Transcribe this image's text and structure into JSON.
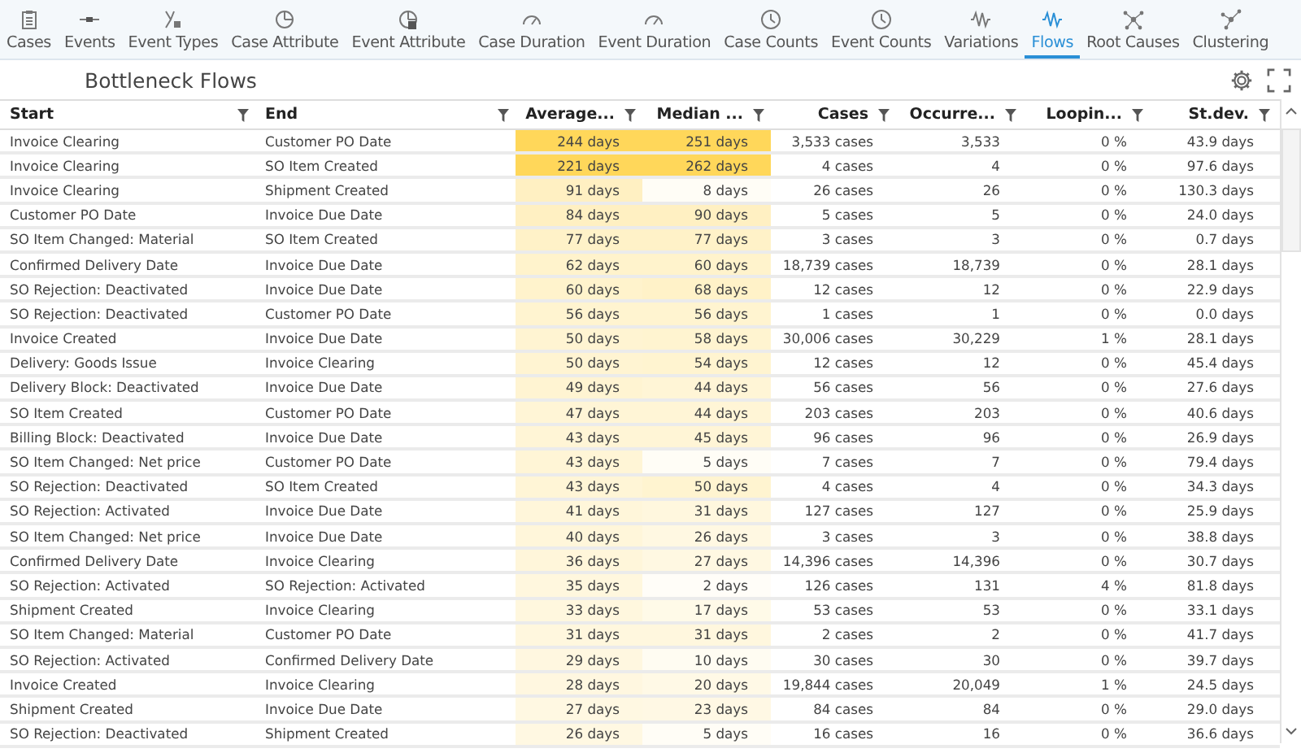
{
  "tabs": [
    {
      "label": "Cases",
      "selected": false
    },
    {
      "label": "Events",
      "selected": false
    },
    {
      "label": "Event Types",
      "selected": false
    },
    {
      "label": "Case Attribute",
      "selected": false
    },
    {
      "label": "Event Attribute",
      "selected": false
    },
    {
      "label": "Case Duration",
      "selected": false
    },
    {
      "label": "Event Duration",
      "selected": false
    },
    {
      "label": "Case Counts",
      "selected": false
    },
    {
      "label": "Event Counts",
      "selected": false
    },
    {
      "label": "Variations",
      "selected": false
    },
    {
      "label": "Flows",
      "selected": true
    },
    {
      "label": "Root Causes",
      "selected": false
    },
    {
      "label": "Clustering",
      "selected": false
    }
  ],
  "panel": {
    "title": "Bottleneck Flows"
  },
  "table": {
    "columns": [
      {
        "label": "Start"
      },
      {
        "label": "End"
      },
      {
        "label": "Average..."
      },
      {
        "label": "Median ..."
      },
      {
        "label": "Cases"
      },
      {
        "label": "Occurre..."
      },
      {
        "label": "Loopin..."
      },
      {
        "label": "St.dev."
      }
    ],
    "rows": [
      {
        "start": "Invoice Clearing",
        "end": "Customer PO Date",
        "average": {
          "text": "244 days",
          "color": "#ffd75a"
        },
        "median": {
          "text": "251 days",
          "color": "#ffd75a"
        },
        "cases": "3,533 cases",
        "occurrences": "3,533",
        "looping": "0 %",
        "stdev": "43.9 days"
      },
      {
        "start": "Invoice Clearing",
        "end": "SO Item Created",
        "average": {
          "text": "221 days",
          "color": "#ffd75a"
        },
        "median": {
          "text": "262 days",
          "color": "#ffd75a"
        },
        "cases": "4 cases",
        "occurrences": "4",
        "looping": "0 %",
        "stdev": "97.6 days"
      },
      {
        "start": "Invoice Clearing",
        "end": "Shipment Created",
        "average": {
          "text": "91 days",
          "color": "#fff0c2"
        },
        "median": {
          "text": "8 days",
          "color": "#fffdf6"
        },
        "cases": "26 cases",
        "occurrences": "26",
        "looping": "0 %",
        "stdev": "130.3 days"
      },
      {
        "start": "Customer PO Date",
        "end": "Invoice Due Date",
        "average": {
          "text": "84 days",
          "color": "#fff0c2"
        },
        "median": {
          "text": "90 days",
          "color": "#fff0c2"
        },
        "cases": "5 cases",
        "occurrences": "5",
        "looping": "0 %",
        "stdev": "24.0 days"
      },
      {
        "start": "SO Item Changed: Material",
        "end": "SO Item Created",
        "average": {
          "text": "77 days",
          "color": "#fff2c8"
        },
        "median": {
          "text": "77 days",
          "color": "#fff2c8"
        },
        "cases": "3 cases",
        "occurrences": "3",
        "looping": "0 %",
        "stdev": "0.7 days"
      },
      {
        "start": "Confirmed Delivery Date",
        "end": "Invoice Due Date",
        "average": {
          "text": "62 days",
          "color": "#fff3cc"
        },
        "median": {
          "text": "60 days",
          "color": "#fff3cc"
        },
        "cases": "18,739 cases",
        "occurrences": "18,739",
        "looping": "0 %",
        "stdev": "28.1 days"
      },
      {
        "start": "SO Rejection: Deactivated",
        "end": "Invoice Due Date",
        "average": {
          "text": "60 days",
          "color": "#fff3cc"
        },
        "median": {
          "text": "68 days",
          "color": "#fff2c8"
        },
        "cases": "12 cases",
        "occurrences": "12",
        "looping": "0 %",
        "stdev": "22.9 days"
      },
      {
        "start": "SO Rejection: Deactivated",
        "end": "Customer PO Date",
        "average": {
          "text": "56 days",
          "color": "#fff4d0"
        },
        "median": {
          "text": "56 days",
          "color": "#fff4d0"
        },
        "cases": "1 cases",
        "occurrences": "1",
        "looping": "0 %",
        "stdev": "0.0 days"
      },
      {
        "start": "Invoice Created",
        "end": "Invoice Due Date",
        "average": {
          "text": "50 days",
          "color": "#fff4d2"
        },
        "median": {
          "text": "58 days",
          "color": "#fff4d0"
        },
        "cases": "30,006 cases",
        "occurrences": "30,229",
        "looping": "1 %",
        "stdev": "28.1 days"
      },
      {
        "start": "Delivery: Goods Issue",
        "end": "Invoice Clearing",
        "average": {
          "text": "50 days",
          "color": "#fff4d2"
        },
        "median": {
          "text": "54 days",
          "color": "#fff4d0"
        },
        "cases": "12 cases",
        "occurrences": "12",
        "looping": "0 %",
        "stdev": "45.4 days"
      },
      {
        "start": "Delivery Block: Deactivated",
        "end": "Invoice Due Date",
        "average": {
          "text": "49 days",
          "color": "#fff4d2"
        },
        "median": {
          "text": "44 days",
          "color": "#fff5d6"
        },
        "cases": "56 cases",
        "occurrences": "56",
        "looping": "0 %",
        "stdev": "27.6 days"
      },
      {
        "start": "SO Item Created",
        "end": "Customer PO Date",
        "average": {
          "text": "47 days",
          "color": "#fff5d6"
        },
        "median": {
          "text": "44 days",
          "color": "#fff5d6"
        },
        "cases": "203 cases",
        "occurrences": "203",
        "looping": "0 %",
        "stdev": "40.6 days"
      },
      {
        "start": "Billing Block: Deactivated",
        "end": "Invoice Due Date",
        "average": {
          "text": "43 days",
          "color": "#fff5d6"
        },
        "median": {
          "text": "45 days",
          "color": "#fff5d6"
        },
        "cases": "96 cases",
        "occurrences": "96",
        "looping": "0 %",
        "stdev": "26.9 days"
      },
      {
        "start": "SO Item Changed: Net price",
        "end": "Customer PO Date",
        "average": {
          "text": "43 days",
          "color": "#fff5d6"
        },
        "median": {
          "text": "5 days",
          "color": "#fffdf6"
        },
        "cases": "7 cases",
        "occurrences": "7",
        "looping": "0 %",
        "stdev": "79.4 days"
      },
      {
        "start": "SO Rejection: Deactivated",
        "end": "SO Item Created",
        "average": {
          "text": "43 days",
          "color": "#fff5d6"
        },
        "median": {
          "text": "50 days",
          "color": "#fff4d0"
        },
        "cases": "4 cases",
        "occurrences": "4",
        "looping": "0 %",
        "stdev": "34.3 days"
      },
      {
        "start": "SO Rejection: Activated",
        "end": "Invoice Due Date",
        "average": {
          "text": "41 days",
          "color": "#fff6da"
        },
        "median": {
          "text": "31 days",
          "color": "#fff7de"
        },
        "cases": "127 cases",
        "occurrences": "127",
        "looping": "0 %",
        "stdev": "25.9 days"
      },
      {
        "start": "SO Item Changed: Net price",
        "end": "Invoice Due Date",
        "average": {
          "text": "40 days",
          "color": "#fff6da"
        },
        "median": {
          "text": "26 days",
          "color": "#fff8e2"
        },
        "cases": "3 cases",
        "occurrences": "3",
        "looping": "0 %",
        "stdev": "38.8 days"
      },
      {
        "start": "Confirmed Delivery Date",
        "end": "Invoice Clearing",
        "average": {
          "text": "36 days",
          "color": "#fff6da"
        },
        "median": {
          "text": "27 days",
          "color": "#fff8e2"
        },
        "cases": "14,396 cases",
        "occurrences": "14,396",
        "looping": "0 %",
        "stdev": "30.7 days"
      },
      {
        "start": "SO Rejection: Activated",
        "end": "SO Rejection: Activated",
        "average": {
          "text": "35 days",
          "color": "#fff7de"
        },
        "median": {
          "text": "2 days",
          "color": "#fffdf8"
        },
        "cases": "126 cases",
        "occurrences": "131",
        "looping": "4 %",
        "stdev": "81.8 days"
      },
      {
        "start": "Shipment Created",
        "end": "Invoice Clearing",
        "average": {
          "text": "33 days",
          "color": "#fff7de"
        },
        "median": {
          "text": "17 days",
          "color": "#fffae8"
        },
        "cases": "53 cases",
        "occurrences": "53",
        "looping": "0 %",
        "stdev": "33.1 days"
      },
      {
        "start": "SO Item Changed: Material",
        "end": "Customer PO Date",
        "average": {
          "text": "31 days",
          "color": "#fff7de"
        },
        "median": {
          "text": "31 days",
          "color": "#fff7de"
        },
        "cases": "2 cases",
        "occurrences": "2",
        "looping": "0 %",
        "stdev": "41.7 days"
      },
      {
        "start": "SO Rejection: Activated",
        "end": "Confirmed Delivery Date",
        "average": {
          "text": "29 days",
          "color": "#fff7e0"
        },
        "median": {
          "text": "10 days",
          "color": "#fffcf2"
        },
        "cases": "30 cases",
        "occurrences": "30",
        "looping": "0 %",
        "stdev": "39.7 days"
      },
      {
        "start": "Invoice Created",
        "end": "Invoice Clearing",
        "average": {
          "text": "28 days",
          "color": "#fff7e0"
        },
        "median": {
          "text": "20 days",
          "color": "#fff9e6"
        },
        "cases": "19,844 cases",
        "occurrences": "20,049",
        "looping": "1 %",
        "stdev": "24.5 days"
      },
      {
        "start": "Shipment Created",
        "end": "Invoice Due Date",
        "average": {
          "text": "27 days",
          "color": "#fff8e2"
        },
        "median": {
          "text": "23 days",
          "color": "#fff8e4"
        },
        "cases": "84 cases",
        "occurrences": "84",
        "looping": "0 %",
        "stdev": "29.0 days"
      },
      {
        "start": "SO Rejection: Deactivated",
        "end": "Shipment Created",
        "average": {
          "text": "26 days",
          "color": "#fff8e2"
        },
        "median": {
          "text": "5 days",
          "color": "#fffdf6"
        },
        "cases": "16 cases",
        "occurrences": "16",
        "looping": "0 %",
        "stdev": "36.6 days"
      }
    ]
  }
}
